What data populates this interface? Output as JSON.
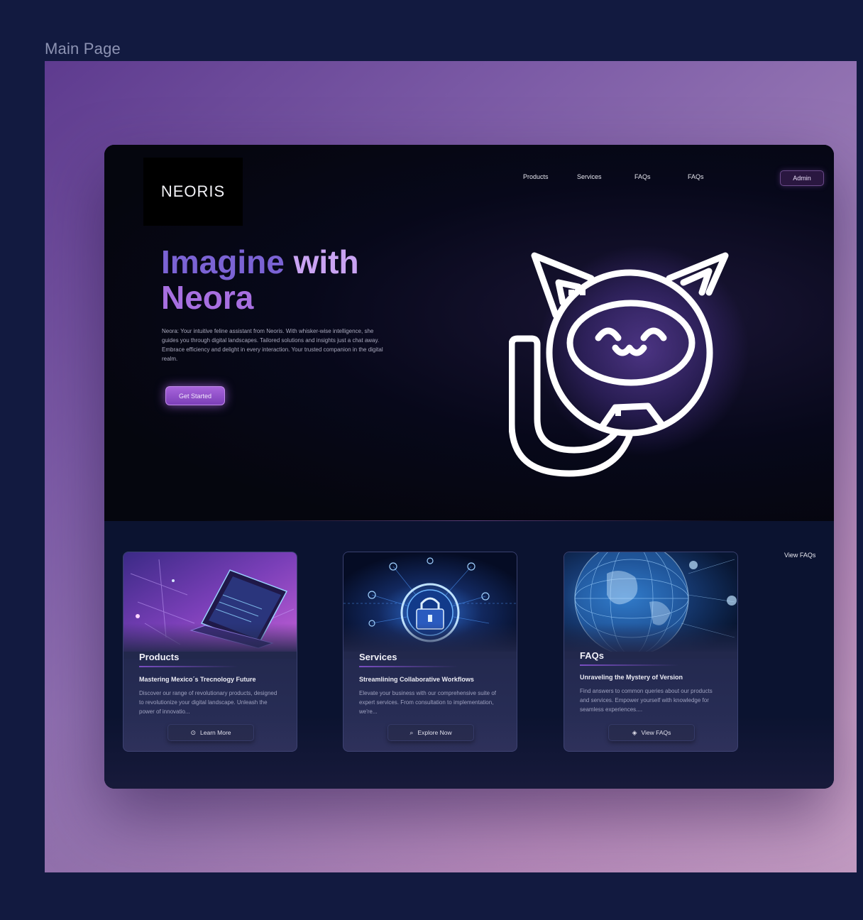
{
  "frame_label": "Main Page",
  "brand": {
    "logo": "NEORIS"
  },
  "nav": {
    "items": [
      "Products",
      "Services",
      "FAQs",
      "FAQs"
    ],
    "admin_label": "Admin"
  },
  "hero": {
    "title_part1": "Imagine",
    "title_part2": "with",
    "title_part3": "Neora",
    "description": "Neora: Your intuitive feline assistant from Neoris. With whisker-wise intelligence, she guides you through digital landscapes. Tailored solutions and insights just a chat away. Embrace efficiency and delight in every interaction. Your trusted companion in the digital realm.",
    "cta_label": "Get Started",
    "mascot_icon": "cat-robot-icon"
  },
  "lower": {
    "view_faqs_label": "View FAQs",
    "cards": [
      {
        "title": "Products",
        "subtitle": "Mastering Mexico´s Trecnology Future",
        "body": "Discover our range of revolutionary products, designed to revolutionize your digital landscape. Unleash the power of innovatio...",
        "button": "Learn More",
        "button_icon": "play-circle-icon"
      },
      {
        "title": "Services",
        "subtitle": "Streamlining Collaborative Workflows",
        "body": "Elevate your business with our comprehensive suite of expert services. From consultation to implementation, we're...",
        "button": "Explore Now",
        "button_icon": "search-icon"
      },
      {
        "title": "FAQs",
        "subtitle": "Unraveling the Mystery of Version",
        "body": "Find answers to common queries about our products and services. Empower yourself with knowledge for seamless experiences....",
        "button": "View FAQs",
        "button_icon": "layers-icon"
      }
    ]
  },
  "colors": {
    "accent": "#a865dc",
    "title_blue": "#7b63d4",
    "title_lilac": "#c9a3f2",
    "window_bg": "#05060e",
    "cards_bg": "#0b1330"
  }
}
